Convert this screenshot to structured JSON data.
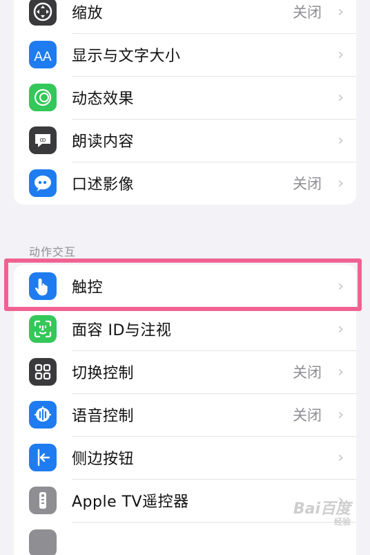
{
  "vision_group": {
    "items": [
      {
        "label": "缩放",
        "value": "关闭"
      },
      {
        "label": "显示与文字大小",
        "value": ""
      },
      {
        "label": "动态效果",
        "value": ""
      },
      {
        "label": "朗读内容",
        "value": ""
      },
      {
        "label": "口述影像",
        "value": "关闭"
      }
    ]
  },
  "physical_group": {
    "header": "动作交互",
    "items": [
      {
        "label": "触控",
        "value": ""
      },
      {
        "label": "面容 ID与注视",
        "value": ""
      },
      {
        "label": "切换控制",
        "value": "关闭"
      },
      {
        "label": "语音控制",
        "value": "关闭"
      },
      {
        "label": "侧边按钮",
        "value": ""
      },
      {
        "label": "Apple TV遥控器",
        "value": ""
      }
    ]
  },
  "icon_glyphs": {
    "zoom": "⊕",
    "display": "AA",
    "motion": "◎",
    "spoken": "ꝏ",
    "audio_desc": "❝",
    "touch": "☝",
    "faceid": "☺",
    "switch": "▦",
    "voice": "◉",
    "side": "|←",
    "remote": "▮"
  },
  "colors": {
    "zoom": "#3a3a3c",
    "display": "#1e7cf0",
    "motion": "#34c759",
    "spoken": "#3a3a3c",
    "audio_desc": "#1e7cf0",
    "touch": "#1e7cf0",
    "faceid": "#34c759",
    "switch": "#3a3a3c",
    "voice": "#1e7cf0",
    "side": "#1e7cf0",
    "remote": "#8e8e93",
    "highlight": "#f06292"
  },
  "watermark": {
    "main": "Bai百度",
    "sub": "经验"
  },
  "chevron": "›"
}
